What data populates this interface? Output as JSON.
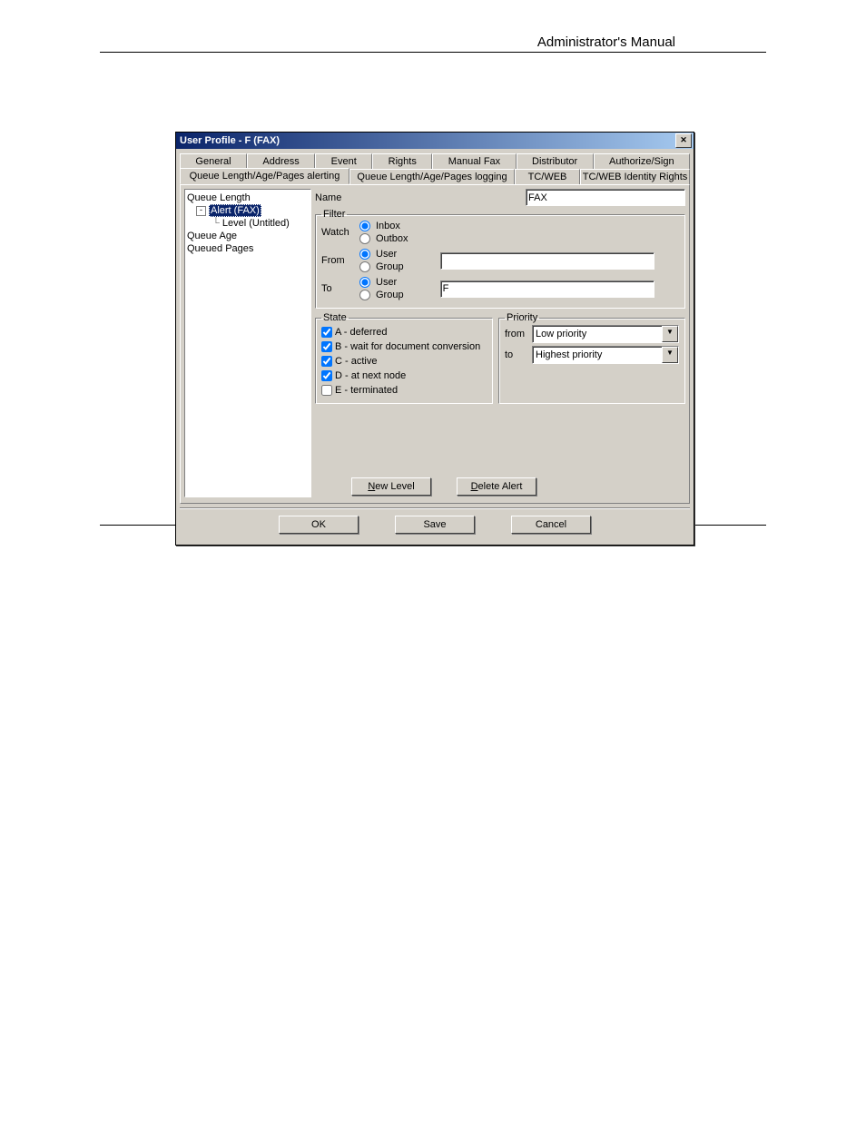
{
  "document": {
    "header": "Administrator's Manual"
  },
  "dialog": {
    "title": "User Profile - F (FAX)",
    "tabs_row1": [
      "General",
      "Address",
      "Event",
      "Rights",
      "Manual Fax",
      "Distributor",
      "Authorize/Sign"
    ],
    "tabs_row2": [
      "Queue Length/Age/Pages alerting",
      "Queue Length/Age/Pages logging",
      "TC/WEB",
      "TC/WEB Identity Rights"
    ],
    "active_tab": "Queue Length/Age/Pages alerting",
    "tree": {
      "items": [
        {
          "label": "Queue Length",
          "level": 0
        },
        {
          "label": "Alert (FAX)",
          "level": 1,
          "selected": true,
          "expander": "-"
        },
        {
          "label": "Level (Untitled)",
          "level": 2,
          "branch": true
        },
        {
          "label": "Queue Age",
          "level": 0
        },
        {
          "label": "Queued Pages",
          "level": 0
        }
      ]
    },
    "name_label": "Name",
    "name_value": "FAX",
    "filter": {
      "legend": "Filter",
      "watch_label": "Watch",
      "watch_options": [
        "Inbox",
        "Outbox"
      ],
      "watch_selected": "Inbox",
      "from_label": "From",
      "from_options": [
        "User",
        "Group"
      ],
      "from_selected": "User",
      "from_value": "",
      "to_label": "To",
      "to_options": [
        "User",
        "Group"
      ],
      "to_selected": "User",
      "to_value": "F"
    },
    "state": {
      "legend": "State",
      "items": [
        {
          "label": "A - deferred",
          "checked": true
        },
        {
          "label": "B - wait for document conversion",
          "checked": true
        },
        {
          "label": "C - active",
          "checked": true
        },
        {
          "label": "D - at next node",
          "checked": true
        },
        {
          "label": "E - terminated",
          "checked": false
        }
      ]
    },
    "priority": {
      "legend": "Priority",
      "from_label": "from",
      "from_value": "Low priority",
      "to_label": "to",
      "to_value": "Highest priority"
    },
    "mid_buttons": {
      "new_level": "New Level",
      "delete_alert": "Delete Alert"
    },
    "footer": {
      "ok": "OK",
      "save": "Save",
      "cancel": "Cancel"
    }
  }
}
